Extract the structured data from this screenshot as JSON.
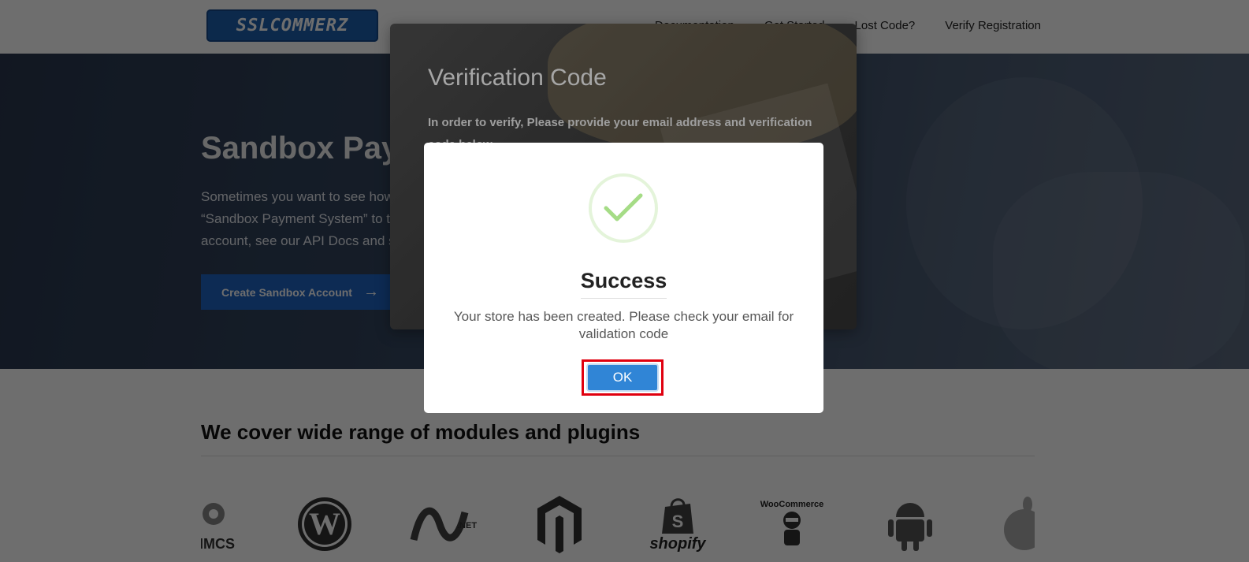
{
  "header": {
    "logo_text": "SSLCOMMERZ",
    "nav": [
      "Documentation",
      "Get Started",
      "Lost Code?",
      "Verify Registration"
    ]
  },
  "hero": {
    "title": "Sandbox Payment System",
    "text_lines": [
      "Sometimes you want to see how our payment gateway",
      "“Sandbox Payment System” to test your integration. Create an",
      "account, see our API Docs and start"
    ],
    "button_label": "Create Sandbox Account",
    "button_arrow": "→"
  },
  "modules": {
    "title": "We cover wide range of modules and plugins",
    "logos": [
      "WHMCS",
      "WordPress",
      "Microsoft .NET",
      "Magento",
      "shopify",
      "WooCommerce",
      "Android",
      "Apple"
    ]
  },
  "verify_modal": {
    "title": "Verification Code",
    "description": "In order to verify, Please provide your email address and verification code below"
  },
  "alert": {
    "icon": "success-check-icon",
    "title": "Success",
    "message": "Your store has been created. Please check your email for validation code",
    "ok_label": "OK"
  },
  "colors": {
    "ok_button": "#3085d6",
    "highlight_border": "#e0000f",
    "success_check": "#a5dc86",
    "brand_blue": "#1d5fb0"
  }
}
